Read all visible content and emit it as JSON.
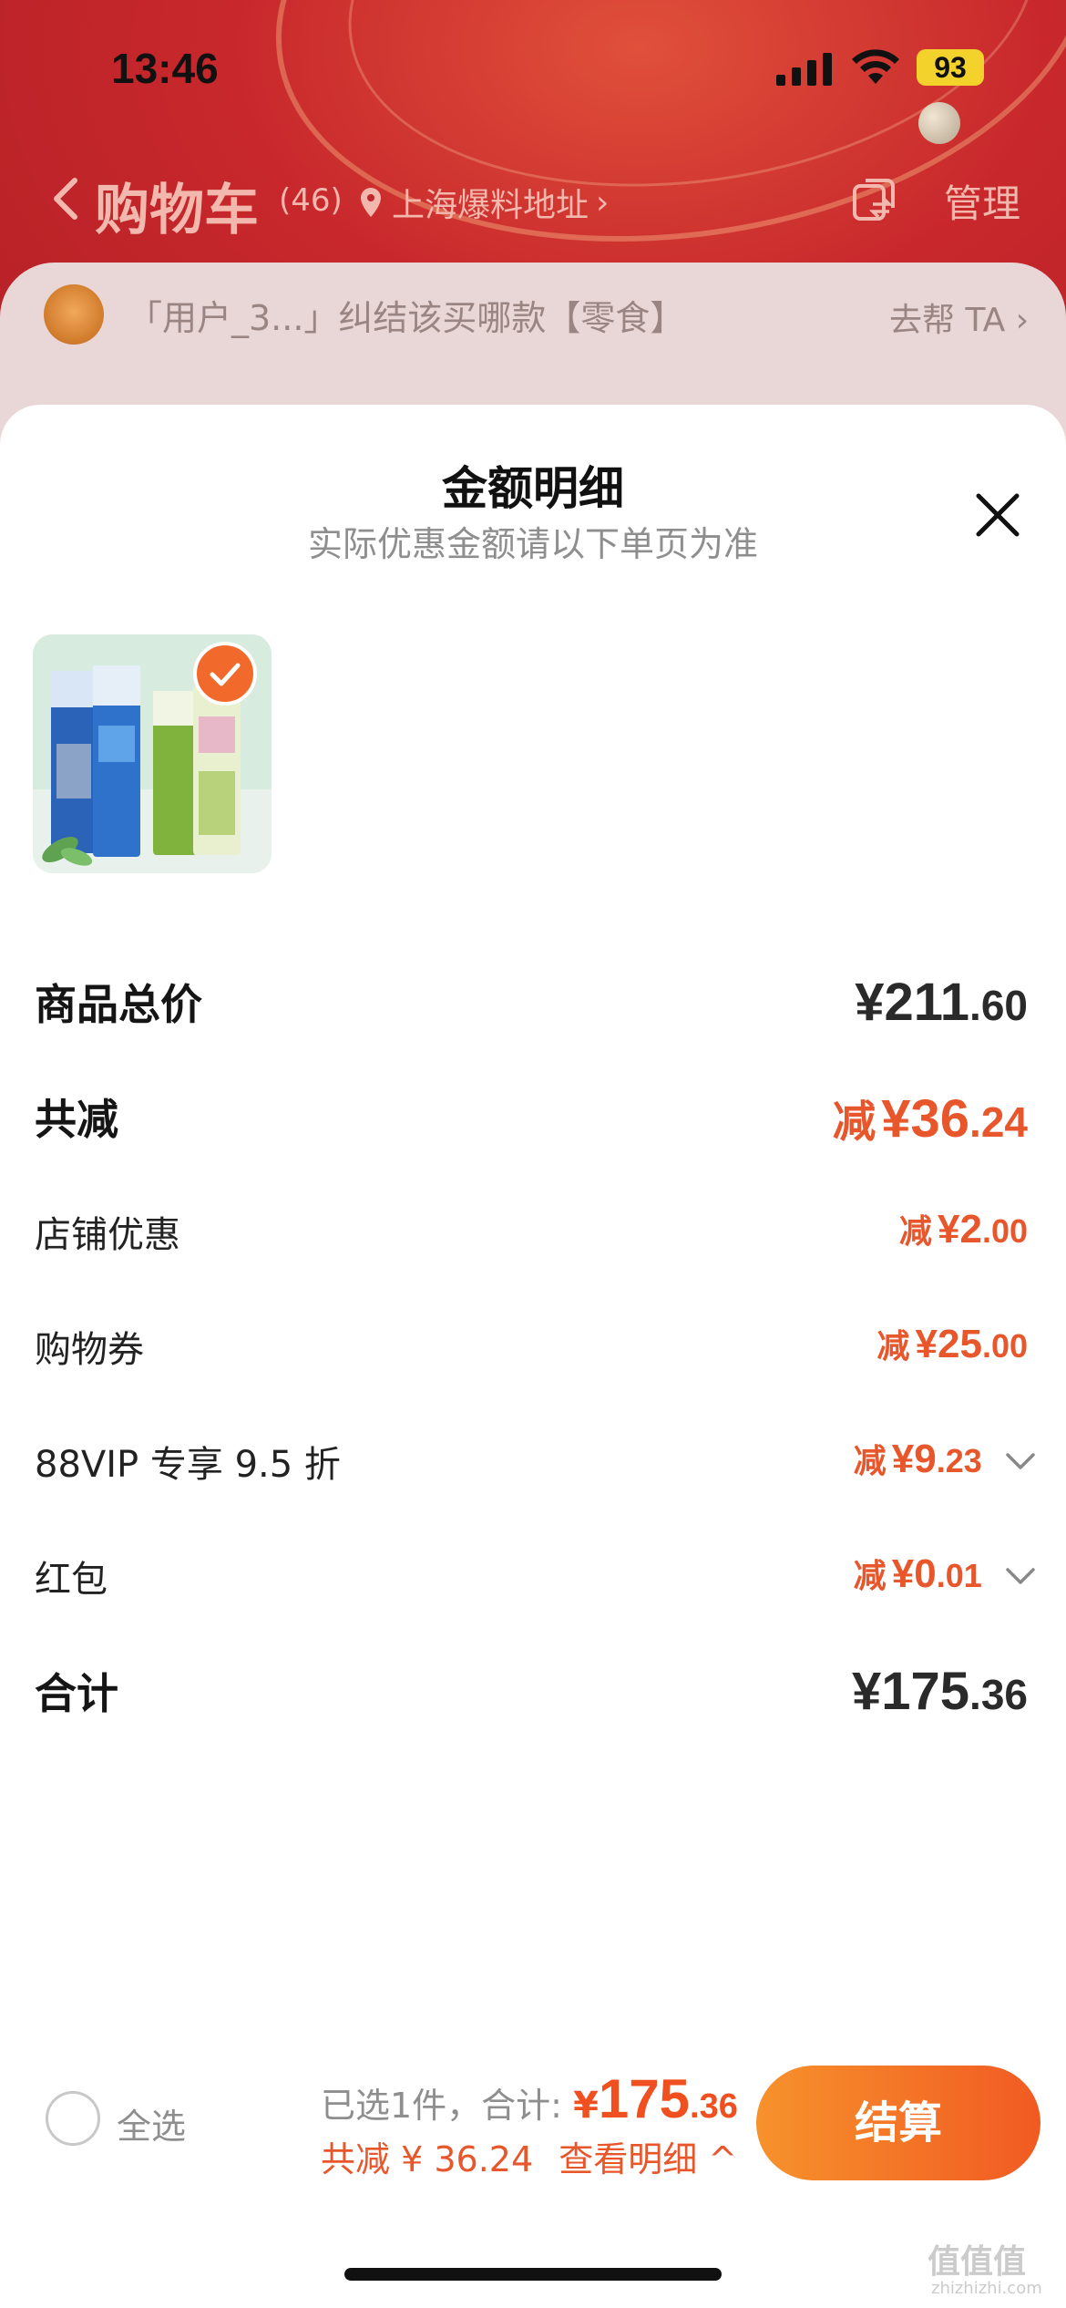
{
  "status_bar": {
    "time": "13:46",
    "battery": "93"
  },
  "nav": {
    "title": "购物车",
    "count": "(46)",
    "location": "上海爆料地址",
    "manage": "管理"
  },
  "notice": {
    "text": "「用户_3...」纠结该买哪款【零食】",
    "link": "去帮 TA"
  },
  "sheet": {
    "title": "金额明细",
    "subtitle": "实际优惠金额请以下单页为准",
    "rows": [
      {
        "label": "商品总价",
        "prefix": "",
        "yen": "¥",
        "int": "211",
        "dec": ".60"
      },
      {
        "label": "共减",
        "prefix": "减",
        "yen": "¥",
        "int": "36",
        "dec": ".24"
      },
      {
        "label": "店铺优惠",
        "prefix": "减",
        "yen": "¥",
        "int": "2",
        "dec": ".00"
      },
      {
        "label": "购物券",
        "prefix": "减",
        "yen": "¥",
        "int": "25",
        "dec": ".00"
      },
      {
        "label": "88VIP 专享 9.5 折",
        "prefix": "减",
        "yen": "¥",
        "int": "9",
        "dec": ".23"
      },
      {
        "label": "红包",
        "prefix": "减",
        "yen": "¥",
        "int": "0",
        "dec": ".01"
      },
      {
        "label": "合计",
        "prefix": "",
        "yen": "¥",
        "int": "175",
        "dec": ".36"
      }
    ]
  },
  "bottom": {
    "select_all": "全选",
    "selected_text": "已选1件，合计:",
    "total_yen": "¥",
    "total_int": "175",
    "total_dec": ".36",
    "discount_text": "共减 ¥ 36.24",
    "detail_link": "查看明细 ^",
    "checkout": "结算"
  },
  "watermark": {
    "main": "值值值",
    "sub": "zhizhizhi.com"
  },
  "colors": {
    "accent_orange": "#e8562b",
    "checkout_gradient_start": "#f7922c",
    "checkout_gradient_end": "#f15a22",
    "header_red": "#c4272a"
  }
}
